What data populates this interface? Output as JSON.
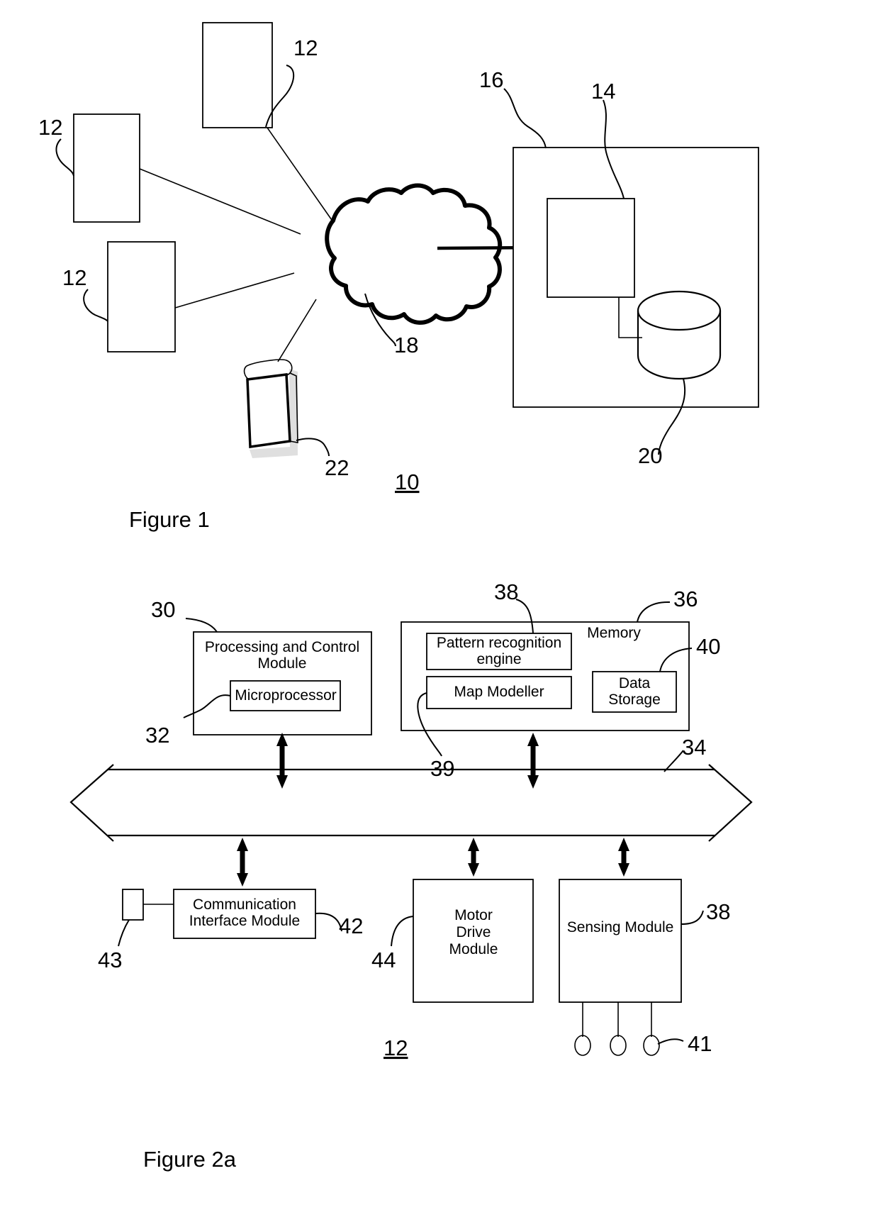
{
  "document": {
    "type": "patent-drawing-sheet",
    "figures": [
      {
        "caption": "Figure 1",
        "system_ref": "10"
      },
      {
        "caption": "Figure 2a",
        "system_ref": "12"
      }
    ]
  },
  "figure1": {
    "caption": "Figure 1",
    "system_ref": "10",
    "nodes": [
      {
        "id": "device-top",
        "ref": "12",
        "label": "",
        "kind": "robot-unit"
      },
      {
        "id": "device-left",
        "ref": "12",
        "label": "",
        "kind": "robot-unit"
      },
      {
        "id": "device-bottom",
        "ref": "12",
        "label": "",
        "kind": "robot-unit"
      },
      {
        "id": "network-cloud",
        "ref": "18",
        "label": "",
        "kind": "cloud"
      },
      {
        "id": "mobile-device",
        "ref": "22",
        "label": "",
        "kind": "handheld"
      },
      {
        "id": "remote-system",
        "ref": "16",
        "label": "",
        "kind": "outer-boundary"
      },
      {
        "id": "server",
        "ref": "14",
        "label": "",
        "kind": "server-box"
      },
      {
        "id": "database",
        "ref": "20",
        "label": "",
        "kind": "cylinder-store"
      }
    ],
    "ref_labels": {
      "device_top": "12",
      "device_left": "12",
      "device_bottom": "12",
      "cloud": "18",
      "mobile": "22",
      "system_boundary": "16",
      "server": "14",
      "database": "20",
      "system": "10"
    }
  },
  "figure2a": {
    "caption": "Figure 2a",
    "system_ref": "12",
    "blocks": {
      "processing_control": {
        "ref": "30",
        "label": "Processing and Control Module"
      },
      "microprocessor": {
        "ref": "32",
        "label": "Microprocessor"
      },
      "memory": {
        "ref": "36",
        "label": "Memory"
      },
      "pattern_engine": {
        "ref": "38",
        "label": "Pattern recognition engine"
      },
      "map_modeller": {
        "ref": "39",
        "label": "Map Modeller"
      },
      "data_storage": {
        "ref": "40",
        "label": "Data Storage"
      },
      "bus": {
        "ref": "34",
        "label": ""
      },
      "comm_interface": {
        "ref": "42",
        "label": "Communication Interface Module"
      },
      "antenna": {
        "ref": "43",
        "label": ""
      },
      "motor_drive": {
        "ref": "44",
        "label": "Motor Drive Module"
      },
      "sensing": {
        "ref": "38",
        "label": "Sensing Module"
      },
      "sensors": {
        "ref": "41",
        "label": ""
      }
    },
    "block_label_lines": {
      "processing_control": [
        "Processing and Control",
        "Module"
      ],
      "pattern_engine": [
        "Pattern recognition",
        "engine"
      ],
      "data_storage": [
        "Data",
        "Storage"
      ],
      "comm_interface": [
        "Communication",
        "Interface Module"
      ],
      "motor_drive": [
        "Motor",
        "Drive",
        "Module"
      ],
      "sensing": [
        "Sensing Module"
      ],
      "memory": [
        "Memory"
      ],
      "microprocessor": [
        "Microprocessor"
      ],
      "map_modeller": [
        "Map Modeller"
      ]
    }
  },
  "colors": {
    "ink": "#000000",
    "paper": "#ffffff",
    "shadow": "#d9d9d9"
  }
}
